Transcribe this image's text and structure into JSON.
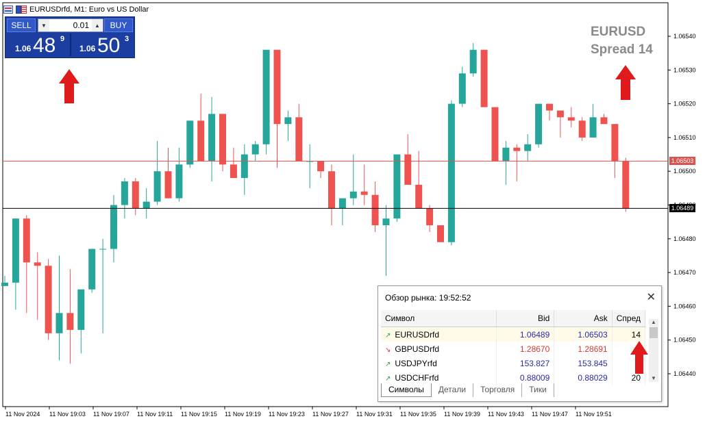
{
  "window": {
    "title": "EURUSDrfd, M1:  Euro vs US Dollar"
  },
  "trade_panel": {
    "sell_label": "SELL",
    "buy_label": "BUY",
    "lot": "0.01",
    "sell_price_prefix": "1.06",
    "sell_price_big": "48",
    "sell_price_sup": "9",
    "buy_price_prefix": "1.06",
    "buy_price_big": "50",
    "buy_price_sup": "3"
  },
  "spread_label": {
    "line1": "EURUSD",
    "line2": "Spread 14"
  },
  "colors": {
    "bull": "#26a69a",
    "bear": "#ef5350",
    "ask_line": "#d9534f",
    "bid_line": "#000000",
    "annotation_arrow": "#e01b1b"
  },
  "price_tags": {
    "ask": "1.06503",
    "bid": "1.06489"
  },
  "chart_data": {
    "type": "candlestick",
    "y_axis_ticks": [
      "1.06540",
      "1.06530",
      "1.06520",
      "1.06510",
      "1.06500",
      "1.06490",
      "1.06480",
      "1.06470",
      "1.06460",
      "1.06450",
      "1.06440"
    ],
    "ylim": [
      1.06437,
      1.06547
    ],
    "x_axis_ticks": [
      "11 Nov 2024",
      "11 Nov 19:03",
      "11 Nov 19:07",
      "11 Nov 19:11",
      "11 Nov 19:15",
      "11 Nov 19:19",
      "11 Nov 19:23",
      "11 Nov 19:27",
      "11 Nov 19:31",
      "11 Nov 19:35",
      "11 Nov 19:39",
      "11 Nov 19:43",
      "11 Nov 19:47",
      "11 Nov 19:51"
    ],
    "ask_level": 1.06503,
    "bid_level": 1.06489,
    "candles": [
      {
        "o": 1.06466,
        "h": 1.06469,
        "l": 1.06466,
        "c": 1.06467
      },
      {
        "o": 1.06467,
        "h": 1.06486,
        "l": 1.06459,
        "c": 1.06486
      },
      {
        "o": 1.06486,
        "h": 1.06487,
        "l": 1.06458,
        "c": 1.06473
      },
      {
        "o": 1.06473,
        "h": 1.06476,
        "l": 1.06456,
        "c": 1.06472
      },
      {
        "o": 1.06472,
        "h": 1.06474,
        "l": 1.0645,
        "c": 1.06452
      },
      {
        "o": 1.06452,
        "h": 1.06475,
        "l": 1.06444,
        "c": 1.06458
      },
      {
        "o": 1.06458,
        "h": 1.06471,
        "l": 1.06443,
        "c": 1.06453
      },
      {
        "o": 1.06453,
        "h": 1.06462,
        "l": 1.06446,
        "c": 1.06465
      },
      {
        "o": 1.06465,
        "h": 1.06477,
        "l": 1.06464,
        "c": 1.06477
      },
      {
        "o": 1.06477,
        "h": 1.0648,
        "l": 1.06452,
        "c": 1.06477
      },
      {
        "o": 1.06477,
        "h": 1.06493,
        "l": 1.06473,
        "c": 1.0649
      },
      {
        "o": 1.0649,
        "h": 1.06498,
        "l": 1.06486,
        "c": 1.06497
      },
      {
        "o": 1.06497,
        "h": 1.06498,
        "l": 1.06487,
        "c": 1.06489
      },
      {
        "o": 1.06489,
        "h": 1.06495,
        "l": 1.06486,
        "c": 1.06491
      },
      {
        "o": 1.06491,
        "h": 1.06509,
        "l": 1.0649,
        "c": 1.065
      },
      {
        "o": 1.065,
        "h": 1.06507,
        "l": 1.06494,
        "c": 1.06492
      },
      {
        "o": 1.06492,
        "h": 1.06507,
        "l": 1.06491,
        "c": 1.06502
      },
      {
        "o": 1.06502,
        "h": 1.06511,
        "l": 1.06501,
        "c": 1.06515
      },
      {
        "o": 1.06515,
        "h": 1.06523,
        "l": 1.06503,
        "c": 1.06503
      },
      {
        "o": 1.06503,
        "h": 1.06522,
        "l": 1.06497,
        "c": 1.06517
      },
      {
        "o": 1.06517,
        "h": 1.06517,
        "l": 1.065,
        "c": 1.06502
      },
      {
        "o": 1.06502,
        "h": 1.06507,
        "l": 1.06499,
        "c": 1.06498
      },
      {
        "o": 1.06498,
        "h": 1.06508,
        "l": 1.06493,
        "c": 1.06505
      },
      {
        "o": 1.06505,
        "h": 1.06509,
        "l": 1.06503,
        "c": 1.06508
      },
      {
        "o": 1.06508,
        "h": 1.06536,
        "l": 1.06505,
        "c": 1.06536
      },
      {
        "o": 1.06536,
        "h": 1.06516,
        "l": 1.06501,
        "c": 1.06514
      },
      {
        "o": 1.06514,
        "h": 1.06518,
        "l": 1.06509,
        "c": 1.06516
      },
      {
        "o": 1.06516,
        "h": 1.0652,
        "l": 1.06503,
        "c": 1.06503
      },
      {
        "o": 1.06503,
        "h": 1.06508,
        "l": 1.06495,
        "c": 1.06503
      },
      {
        "o": 1.06503,
        "h": 1.06503,
        "l": 1.06498,
        "c": 1.065
      },
      {
        "o": 1.065,
        "h": 1.06502,
        "l": 1.06484,
        "c": 1.06489
      },
      {
        "o": 1.06489,
        "h": 1.06492,
        "l": 1.06484,
        "c": 1.06492
      },
      {
        "o": 1.06492,
        "h": 1.06505,
        "l": 1.0649,
        "c": 1.06494
      },
      {
        "o": 1.06494,
        "h": 1.06502,
        "l": 1.0649,
        "c": 1.06493
      },
      {
        "o": 1.06493,
        "h": 1.06497,
        "l": 1.06482,
        "c": 1.06484
      },
      {
        "o": 1.06484,
        "h": 1.0649,
        "l": 1.06469,
        "c": 1.06486
      },
      {
        "o": 1.06486,
        "h": 1.06505,
        "l": 1.06485,
        "c": 1.06505
      },
      {
        "o": 1.06505,
        "h": 1.06511,
        "l": 1.06497,
        "c": 1.06496
      },
      {
        "o": 1.06496,
        "h": 1.06506,
        "l": 1.06489,
        "c": 1.06489
      },
      {
        "o": 1.06489,
        "h": 1.0649,
        "l": 1.06482,
        "c": 1.06484
      },
      {
        "o": 1.06484,
        "h": 1.06484,
        "l": 1.06479,
        "c": 1.06479
      },
      {
        "o": 1.06479,
        "h": 1.06521,
        "l": 1.06478,
        "c": 1.0652
      },
      {
        "o": 1.0652,
        "h": 1.06531,
        "l": 1.06519,
        "c": 1.06529
      },
      {
        "o": 1.06529,
        "h": 1.06538,
        "l": 1.06528,
        "c": 1.06536
      },
      {
        "o": 1.06536,
        "h": 1.06536,
        "l": 1.06519,
        "c": 1.06519
      },
      {
        "o": 1.06519,
        "h": 1.06519,
        "l": 1.06503,
        "c": 1.06503
      },
      {
        "o": 1.06503,
        "h": 1.06509,
        "l": 1.06496,
        "c": 1.06507
      },
      {
        "o": 1.06507,
        "h": 1.06508,
        "l": 1.06497,
        "c": 1.06506
      },
      {
        "o": 1.06506,
        "h": 1.06511,
        "l": 1.06503,
        "c": 1.06508
      },
      {
        "o": 1.06508,
        "h": 1.0652,
        "l": 1.06507,
        "c": 1.0652
      },
      {
        "o": 1.0652,
        "h": 1.0652,
        "l": 1.06515,
        "c": 1.06518
      },
      {
        "o": 1.06518,
        "h": 1.06518,
        "l": 1.0651,
        "c": 1.06516
      },
      {
        "o": 1.06516,
        "h": 1.06519,
        "l": 1.06513,
        "c": 1.06515
      },
      {
        "o": 1.06515,
        "h": 1.06516,
        "l": 1.06509,
        "c": 1.0651
      },
      {
        "o": 1.0651,
        "h": 1.0652,
        "l": 1.0651,
        "c": 1.06516
      },
      {
        "o": 1.06516,
        "h": 1.06517,
        "l": 1.06514,
        "c": 1.06514
      },
      {
        "o": 1.06514,
        "h": 1.06514,
        "l": 1.06498,
        "c": 1.06503
      },
      {
        "o": 1.06503,
        "h": 1.06504,
        "l": 1.06488,
        "c": 1.06489
      }
    ]
  },
  "market_watch": {
    "title": "Обзор рынка: 19:52:52",
    "headers": {
      "symbol": "Символ",
      "bid": "Bid",
      "ask": "Ask",
      "spread": "Спред"
    },
    "rows": [
      {
        "symbol": "EURUSDrfd",
        "bid": "1.06489",
        "ask": "1.06503",
        "spread": "14",
        "dir": "up",
        "bid_color": "#2a2aa8",
        "ask_color": "#2a2aa8"
      },
      {
        "symbol": "GBPUSDrfd",
        "bid": "1.28670",
        "ask": "1.28691",
        "spread": "",
        "dir": "down",
        "bid_color": "#d13a3a",
        "ask_color": "#d13a3a"
      },
      {
        "symbol": "USDJPYrfd",
        "bid": "153.827",
        "ask": "153.845",
        "spread": "",
        "dir": "up",
        "bid_color": "#2a2aa8",
        "ask_color": "#2a2aa8"
      },
      {
        "symbol": "USDCHFrfd",
        "bid": "0.88009",
        "ask": "0.88029",
        "spread": "20",
        "dir": "up",
        "bid_color": "#2a2aa8",
        "ask_color": "#2a2aa8"
      }
    ],
    "tabs": [
      "Символы",
      "Детали",
      "Торговля",
      "Тики"
    ],
    "active_tab": "Символы"
  }
}
